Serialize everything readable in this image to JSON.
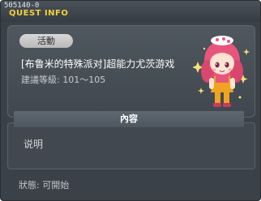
{
  "window": {
    "quest_id": "505140-0",
    "title": "QUEST INFO"
  },
  "quest": {
    "type_label": "活動",
    "name": "[布鲁米的特殊派对]超能力尤茨游戏",
    "level_label": "建議等級:",
    "level_range": "101～105"
  },
  "content": {
    "header": "內容",
    "description": "说明"
  },
  "status": {
    "label": "狀態:",
    "value": "可開始"
  },
  "colors": {
    "title_accent": "#f2d23c",
    "window_bg": "#3a4148"
  }
}
